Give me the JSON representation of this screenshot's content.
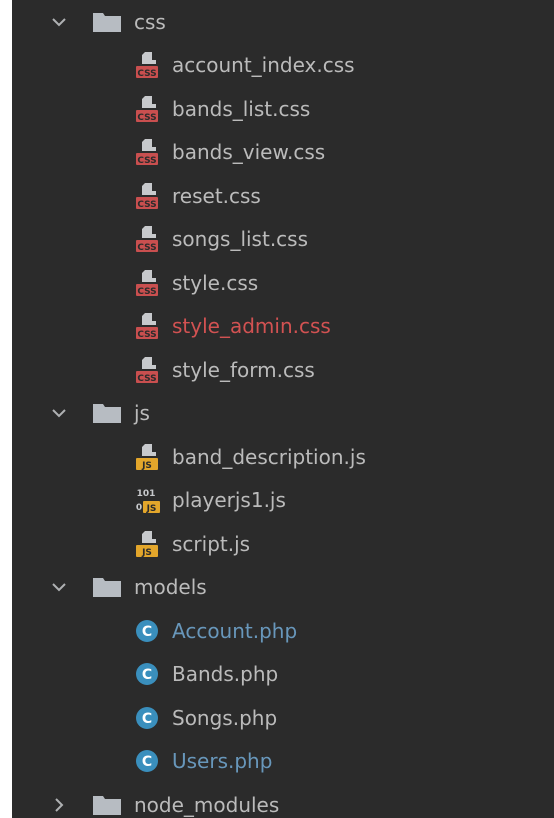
{
  "colors": {
    "panel_bg": "#2b2b2b",
    "text": "#bbbbbb",
    "modified": "#6897bb",
    "error": "#d25252",
    "css_badge": "#c94f4f",
    "js_badge": "#e3a62b",
    "class_icon": "#3a8fbd"
  },
  "tree": [
    {
      "kind": "folder",
      "label": "css",
      "expanded": true,
      "icon": "folder-icon"
    },
    {
      "kind": "file",
      "label": "account_index.css",
      "icon": "css-file-icon",
      "status": "normal"
    },
    {
      "kind": "file",
      "label": "bands_list.css",
      "icon": "css-file-icon",
      "status": "normal"
    },
    {
      "kind": "file",
      "label": "bands_view.css",
      "icon": "css-file-icon",
      "status": "normal"
    },
    {
      "kind": "file",
      "label": "reset.css",
      "icon": "css-file-icon",
      "status": "normal"
    },
    {
      "kind": "file",
      "label": "songs_list.css",
      "icon": "css-file-icon",
      "status": "normal"
    },
    {
      "kind": "file",
      "label": "style.css",
      "icon": "css-file-icon",
      "status": "normal"
    },
    {
      "kind": "file",
      "label": "style_admin.css",
      "icon": "css-file-icon",
      "status": "error"
    },
    {
      "kind": "file",
      "label": "style_form.css",
      "icon": "css-file-icon",
      "status": "normal"
    },
    {
      "kind": "folder",
      "label": "js",
      "expanded": true,
      "icon": "folder-icon"
    },
    {
      "kind": "file",
      "label": "band_description.js",
      "icon": "js-file-icon",
      "status": "normal"
    },
    {
      "kind": "file",
      "label": "playerjs1.js",
      "icon": "binary-js-file-icon",
      "status": "normal"
    },
    {
      "kind": "file",
      "label": "script.js",
      "icon": "js-file-icon",
      "status": "normal"
    },
    {
      "kind": "folder",
      "label": "models",
      "expanded": true,
      "icon": "folder-icon"
    },
    {
      "kind": "file",
      "label": "Account.php",
      "icon": "php-class-icon",
      "status": "modified"
    },
    {
      "kind": "file",
      "label": "Bands.php",
      "icon": "php-class-icon",
      "status": "normal"
    },
    {
      "kind": "file",
      "label": "Songs.php",
      "icon": "php-class-icon",
      "status": "normal"
    },
    {
      "kind": "file",
      "label": "Users.php",
      "icon": "php-class-icon",
      "status": "modified"
    },
    {
      "kind": "folder",
      "label": "node_modules",
      "expanded": false,
      "icon": "folder-icon"
    }
  ]
}
